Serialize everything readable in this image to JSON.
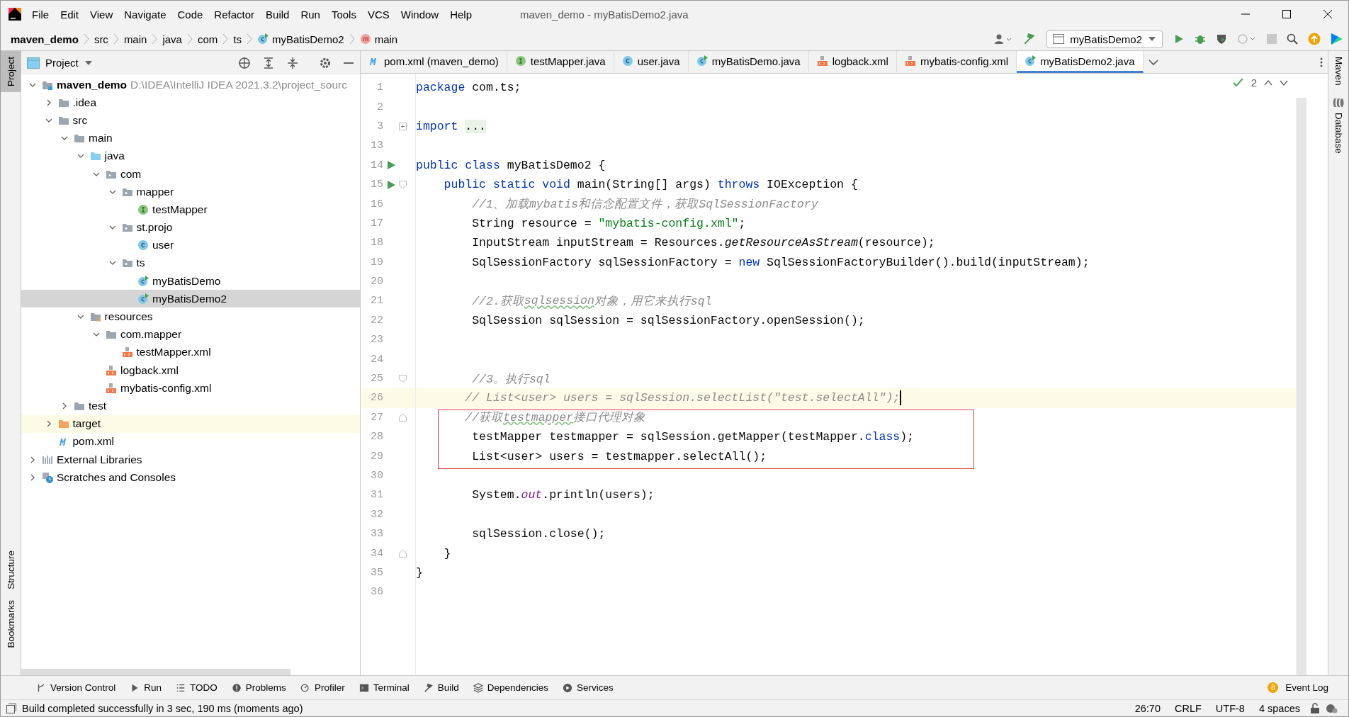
{
  "window": {
    "title": "maven_demo - myBatisDemo2.java",
    "menu": [
      "File",
      "Edit",
      "View",
      "Navigate",
      "Code",
      "Refactor",
      "Build",
      "Run",
      "Tools",
      "VCS",
      "Window",
      "Help"
    ]
  },
  "breadcrumbs": [
    {
      "label": "maven_demo",
      "kind": "module"
    },
    {
      "label": "src",
      "kind": "plain"
    },
    {
      "label": "main",
      "kind": "plain"
    },
    {
      "label": "java",
      "kind": "plain"
    },
    {
      "label": "com",
      "kind": "plain"
    },
    {
      "label": "ts",
      "kind": "plain"
    },
    {
      "label": "myBatisDemo2",
      "kind": "class"
    },
    {
      "label": "main",
      "kind": "method"
    }
  ],
  "run_config": {
    "label": "myBatisDemo2"
  },
  "left_strip": [
    {
      "label": "Project",
      "selected": true
    },
    {
      "label": "Structure",
      "selected": false
    },
    {
      "label": "Bookmarks",
      "selected": false
    }
  ],
  "right_strip": [
    {
      "label": "Maven",
      "kind": "maven"
    },
    {
      "label": "Database",
      "kind": "database"
    }
  ],
  "project_panel": {
    "title": "Project",
    "tree": [
      {
        "name": "maven_demo",
        "detail": "D:\\IDEA\\IntelliJ IDEA 2021.3.2\\project_sourc",
        "kind": "module",
        "expanded": true,
        "selected": false,
        "children": [
          {
            "name": ".idea",
            "kind": "folder",
            "expanded": false,
            "selected": false
          },
          {
            "name": "src",
            "kind": "folder",
            "expanded": true,
            "selected": false,
            "children": [
              {
                "name": "main",
                "kind": "folder",
                "expanded": true,
                "selected": false,
                "children": [
                  {
                    "name": "java",
                    "kind": "source",
                    "expanded": true,
                    "selected": false,
                    "children": [
                      {
                        "name": "com",
                        "kind": "package",
                        "expanded": true,
                        "selected": false,
                        "children": [
                          {
                            "name": "mapper",
                            "kind": "package",
                            "expanded": true,
                            "selected": false,
                            "children": [
                              {
                                "name": "testMapper",
                                "kind": "interface",
                                "selected": false
                              }
                            ]
                          },
                          {
                            "name": "st.projo",
                            "kind": "package",
                            "expanded": true,
                            "selected": false,
                            "children": [
                              {
                                "name": "user",
                                "kind": "class",
                                "selected": false
                              }
                            ]
                          },
                          {
                            "name": "ts",
                            "kind": "package",
                            "expanded": true,
                            "selected": false,
                            "children": [
                              {
                                "name": "myBatisDemo",
                                "kind": "runnable",
                                "selected": false
                              },
                              {
                                "name": "myBatisDemo2",
                                "kind": "runnable",
                                "selected": true
                              }
                            ]
                          }
                        ]
                      }
                    ]
                  },
                  {
                    "name": "resources",
                    "kind": "resources",
                    "expanded": true,
                    "selected": false,
                    "children": [
                      {
                        "name": "com.mapper",
                        "kind": "folder",
                        "expanded": true,
                        "selected": false,
                        "children": [
                          {
                            "name": "testMapper.xml",
                            "kind": "xml",
                            "selected": false
                          }
                        ]
                      },
                      {
                        "name": "logback.xml",
                        "kind": "xml",
                        "selected": false
                      },
                      {
                        "name": "mybatis-config.xml",
                        "kind": "xml",
                        "selected": false
                      }
                    ]
                  }
                ]
              },
              {
                "name": "test",
                "kind": "folder",
                "expanded": false,
                "selected": false
              }
            ]
          },
          {
            "name": "target",
            "kind": "excluded",
            "expanded": false,
            "selected": false,
            "highlighted": true
          },
          {
            "name": "pom.xml",
            "kind": "maven",
            "selected": false
          }
        ]
      },
      {
        "name": "External Libraries",
        "kind": "libraries",
        "expanded": false,
        "selected": false
      },
      {
        "name": "Scratches and Consoles",
        "kind": "scratches",
        "expanded": false,
        "selected": false
      }
    ]
  },
  "tabs": [
    {
      "label": "pom.xml (maven_demo)",
      "kind": "maven",
      "selected": false
    },
    {
      "label": "testMapper.java",
      "kind": "interface",
      "selected": false
    },
    {
      "label": "user.java",
      "kind": "class",
      "selected": false
    },
    {
      "label": "myBatisDemo.java",
      "kind": "runnable",
      "selected": false
    },
    {
      "label": "logback.xml",
      "kind": "xml",
      "selected": false
    },
    {
      "label": "mybatis-config.xml",
      "kind": "xml",
      "selected": false
    },
    {
      "label": "myBatisDemo2.java",
      "kind": "runnable",
      "selected": true
    }
  ],
  "inspection": {
    "count": "2"
  },
  "code": [
    {
      "number": "1",
      "segments": [
        {
          "kind": "keyword",
          "text": "package"
        },
        {
          "kind": "plain",
          "text": " com.ts;"
        }
      ]
    },
    {
      "number": "2"
    },
    {
      "number": "3",
      "folded": true,
      "segments": [
        {
          "kind": "keyword",
          "text": "import "
        },
        {
          "kind": "folded",
          "text": "..."
        }
      ]
    },
    {
      "number": "13"
    },
    {
      "number": "14",
      "run": true,
      "segments": [
        {
          "kind": "keyword",
          "text": "public class"
        },
        {
          "kind": "plain",
          "text": " myBatisDemo2 {"
        }
      ]
    },
    {
      "number": "15",
      "run": true,
      "fold_start": true,
      "segments": [
        {
          "kind": "keyword",
          "text": "    public static void"
        },
        {
          "kind": "plain",
          "text": " main(String[] args) "
        },
        {
          "kind": "keyword",
          "text": "throws"
        },
        {
          "kind": "plain",
          "text": " IOException {"
        }
      ]
    },
    {
      "number": "16",
      "segments": [
        {
          "kind": "comment",
          "text": "        //1、加载mybatis和信念配置文件，获取SqlSessionFactory"
        }
      ]
    },
    {
      "number": "17",
      "segments": [
        {
          "kind": "plain",
          "text": "        String resource = "
        },
        {
          "kind": "string",
          "text": "\"mybatis-config.xml\""
        },
        {
          "kind": "plain",
          "text": ";"
        }
      ]
    },
    {
      "number": "18",
      "segments": [
        {
          "kind": "plain",
          "text": "        InputStream inputStream = Resources."
        },
        {
          "kind": "static",
          "text": "getResourceAsStream"
        },
        {
          "kind": "plain",
          "text": "(resource);"
        }
      ]
    },
    {
      "number": "19",
      "segments": [
        {
          "kind": "plain",
          "text": "        SqlSessionFactory sqlSessionFactory = "
        },
        {
          "kind": "keyword",
          "text": "new"
        },
        {
          "kind": "plain",
          "text": " SqlSessionFactoryBuilder().build(inputStream);"
        }
      ]
    },
    {
      "number": "20"
    },
    {
      "number": "21",
      "segments": [
        {
          "kind": "comment",
          "text": "        //2.获取"
        },
        {
          "kind": "typo",
          "text": "sqlsession"
        },
        {
          "kind": "comment",
          "text": "对象，用它来执行sql"
        }
      ]
    },
    {
      "number": "22",
      "segments": [
        {
          "kind": "plain",
          "text": "        SqlSession sqlSession = sqlSessionFactory.openSession();"
        }
      ]
    },
    {
      "number": "23"
    },
    {
      "number": "24"
    },
    {
      "number": "25",
      "fold_start": true,
      "segments": [
        {
          "kind": "comment",
          "text": "        //3。执行sql"
        }
      ]
    },
    {
      "number": "26",
      "current": true,
      "segments": [
        {
          "kind": "comment",
          "text": "       // List<user> users = sqlSession.selectList(\"test.selectAll\");"
        }
      ]
    },
    {
      "number": "27",
      "boxed": true,
      "fold_end": true,
      "segments": [
        {
          "kind": "comment",
          "text": "       //获取"
        },
        {
          "kind": "typo",
          "text": "testmapper"
        },
        {
          "kind": "comment",
          "text": "接口代理对象"
        }
      ]
    },
    {
      "number": "28",
      "boxed": true,
      "segments": [
        {
          "kind": "plain",
          "text": "        testMapper testmapper = sqlSession.getMapper(testMapper."
        },
        {
          "kind": "keyword",
          "text": "class"
        },
        {
          "kind": "plain",
          "text": ");"
        }
      ]
    },
    {
      "number": "29",
      "boxed": true,
      "segments": [
        {
          "kind": "plain",
          "text": "        List<user> users = testmapper.selectAll();"
        }
      ]
    },
    {
      "number": "30"
    },
    {
      "number": "31",
      "segments": [
        {
          "kind": "plain",
          "text": "        System."
        },
        {
          "kind": "field",
          "text": "out"
        },
        {
          "kind": "plain",
          "text": ".println(users);"
        }
      ]
    },
    {
      "number": "32"
    },
    {
      "number": "33",
      "segments": [
        {
          "kind": "plain",
          "text": "        sqlSession.close();"
        }
      ]
    },
    {
      "number": "34",
      "fold_end": true,
      "segments": [
        {
          "kind": "plain",
          "text": "    }"
        }
      ]
    },
    {
      "number": "35",
      "segments": [
        {
          "kind": "plain",
          "text": "}"
        }
      ]
    },
    {
      "number": "36"
    }
  ],
  "tool_windows": [
    {
      "label": "Version Control",
      "kind": "vcs"
    },
    {
      "label": "Run",
      "kind": "run"
    },
    {
      "label": "TODO",
      "kind": "todo"
    },
    {
      "label": "Problems",
      "kind": "problems"
    },
    {
      "label": "Profiler",
      "kind": "profiler"
    },
    {
      "label": "Terminal",
      "kind": "terminal"
    },
    {
      "label": "Build",
      "kind": "build"
    },
    {
      "label": "Dependencies",
      "kind": "dependencies"
    },
    {
      "label": "Services",
      "kind": "services"
    }
  ],
  "event_log": {
    "label": "Event Log",
    "badge": "8"
  },
  "status_bar": {
    "message": "Build completed successfully in 3 sec, 190 ms (moments ago)",
    "items": [
      "26:70",
      "CRLF",
      "UTF-8",
      "4 spaces"
    ]
  }
}
